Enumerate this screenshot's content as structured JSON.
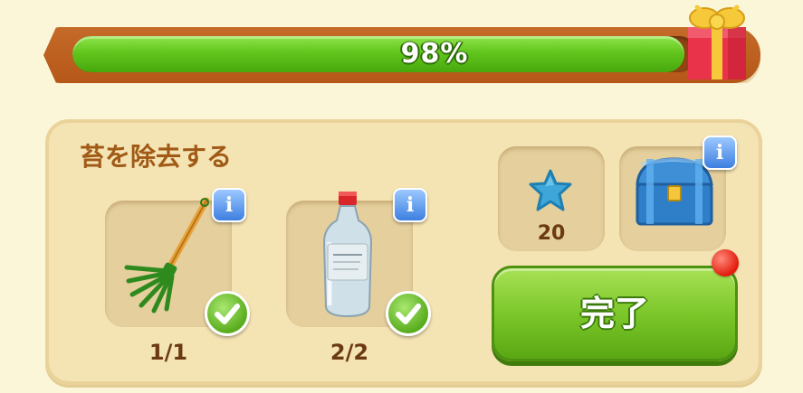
{
  "progress": {
    "percent": 0.98,
    "label": "98%"
  },
  "quest": {
    "title": "苔を除去する",
    "items": [
      {
        "icon": "rake-icon",
        "count": "1/1",
        "completed": true
      },
      {
        "icon": "solvent-bottle-icon",
        "count": "2/2",
        "completed": true
      }
    ]
  },
  "rewards": {
    "star": {
      "icon": "blue-star-icon",
      "amount": "20"
    },
    "chest": {
      "icon": "treasure-chest-icon"
    }
  },
  "actions": {
    "done_label": "完了"
  },
  "colors": {
    "progress_green": "#62c61e",
    "frame_orange": "#c56a28",
    "info_blue": "#3d7fe0",
    "title_brown": "#a05a16"
  }
}
